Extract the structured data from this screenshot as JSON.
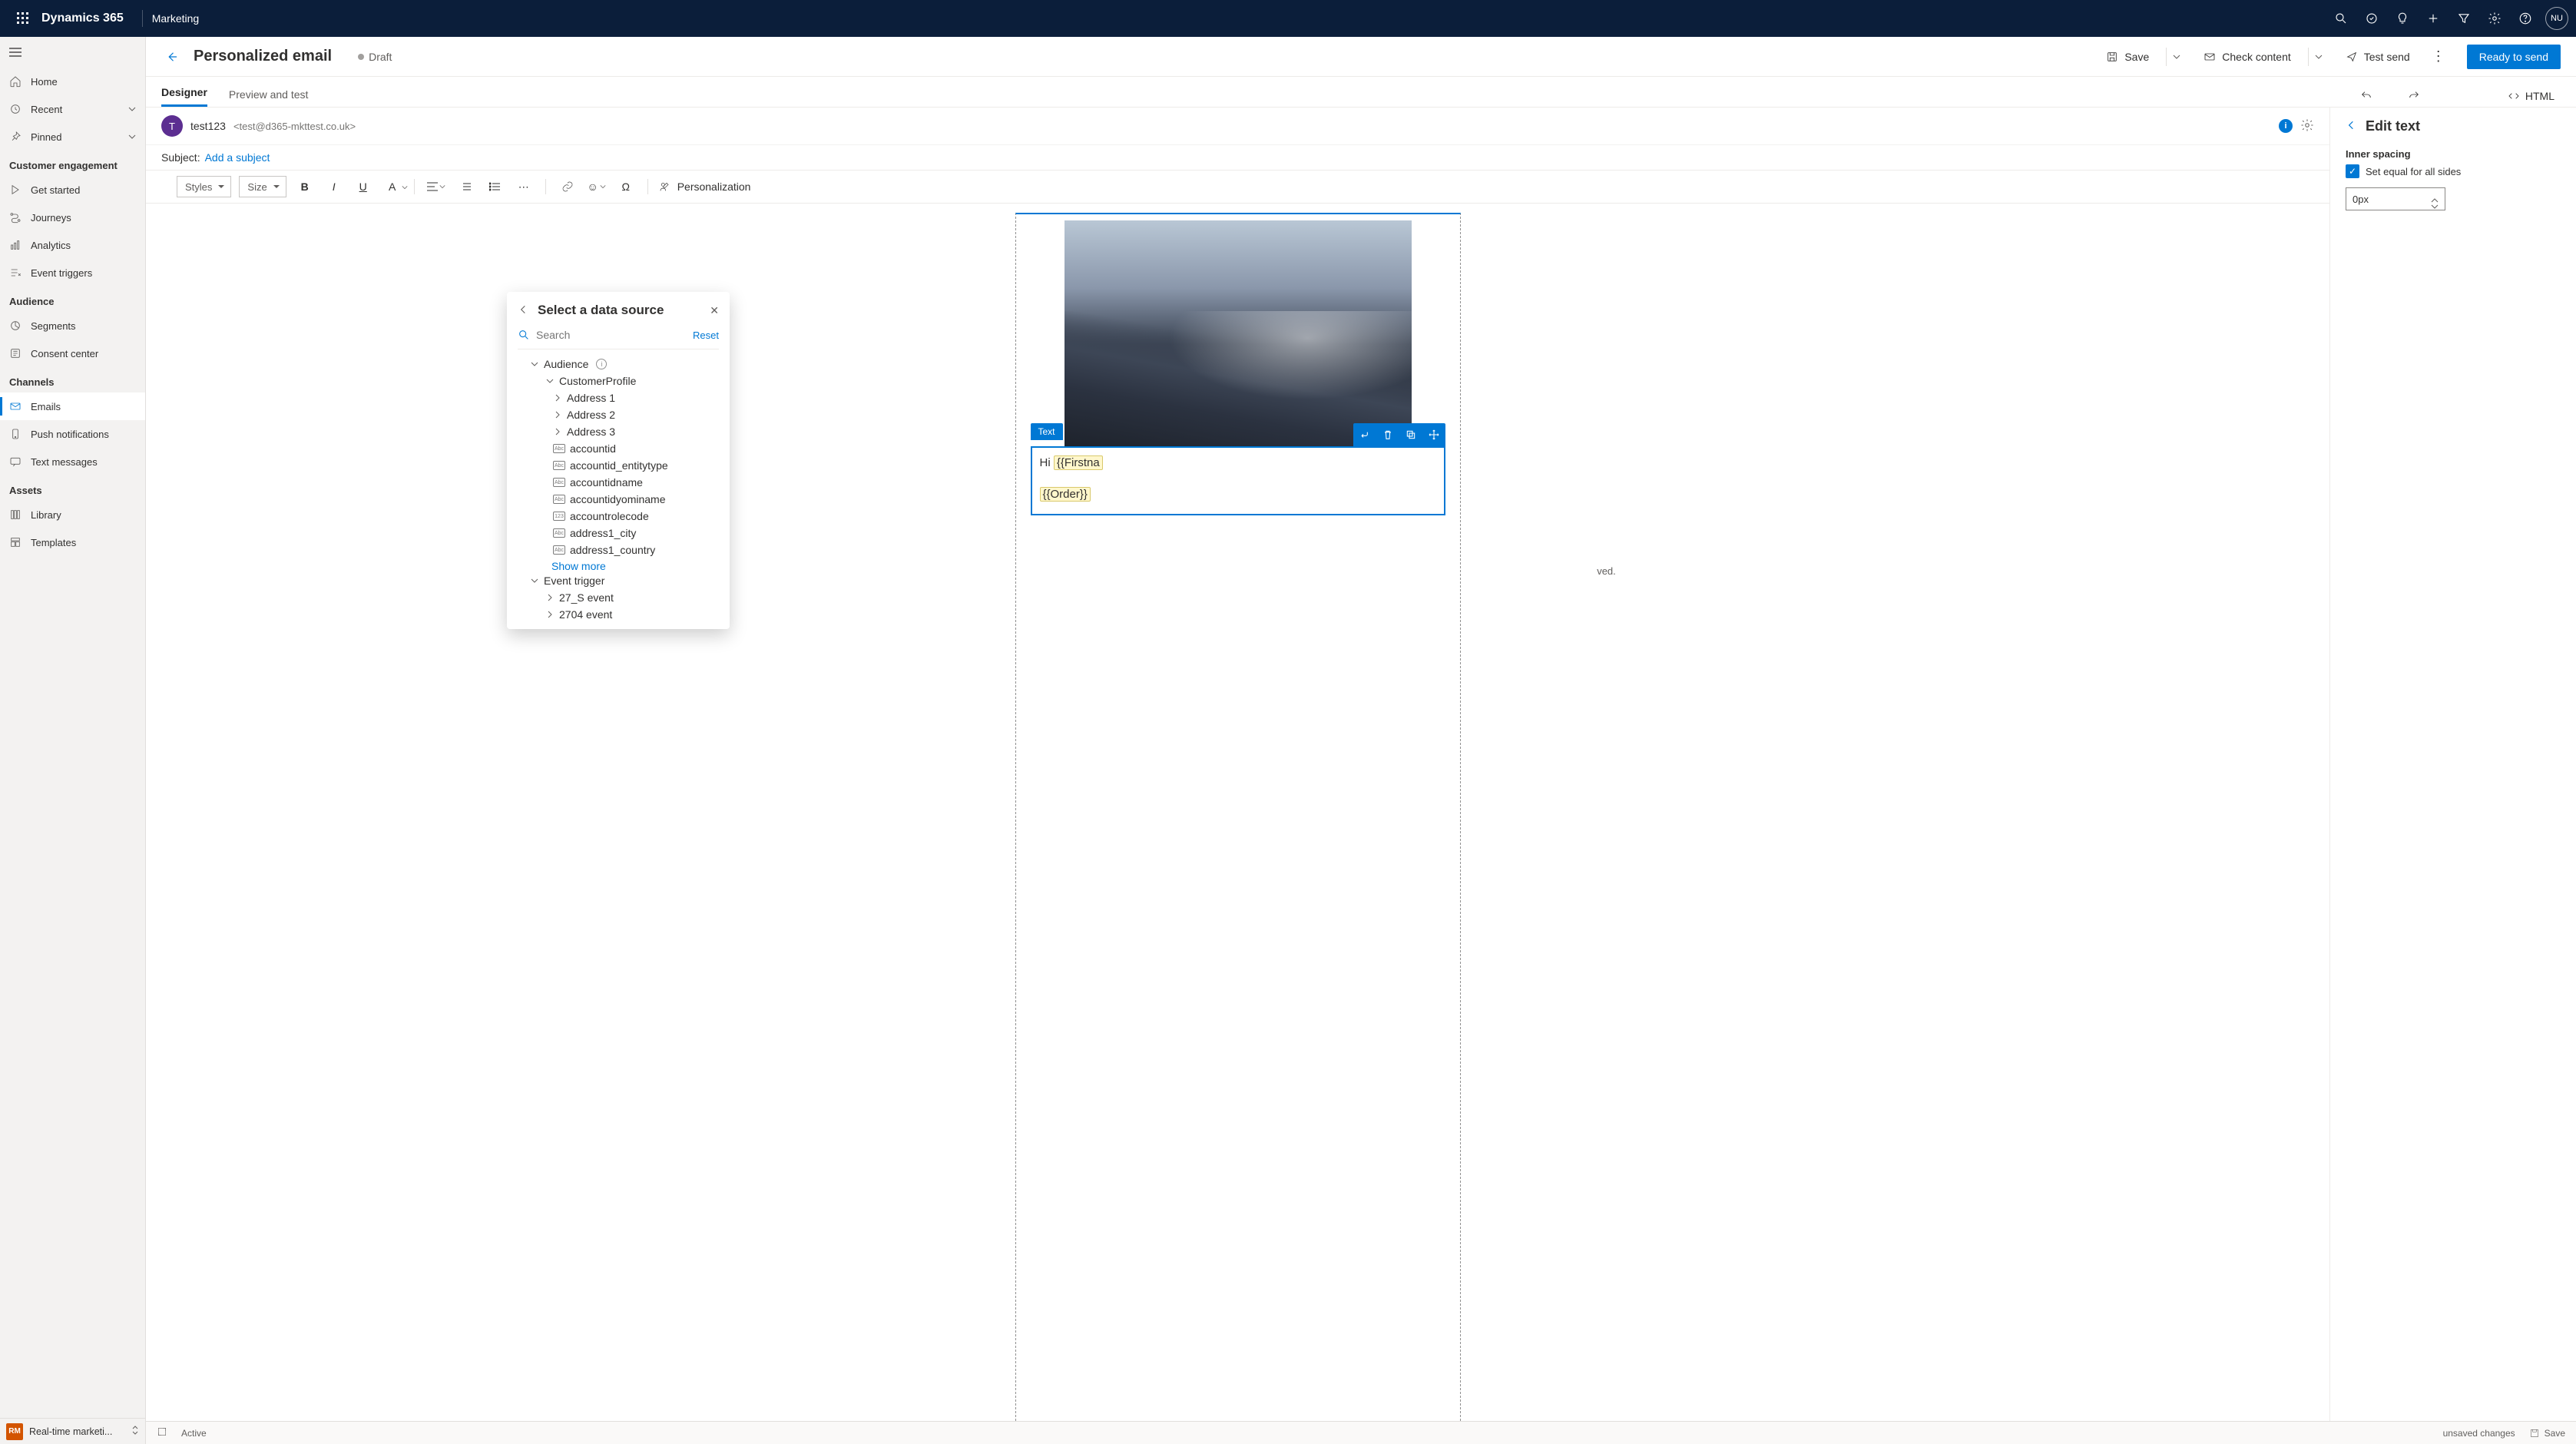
{
  "topbar": {
    "brand": "Dynamics 365",
    "module": "Marketing",
    "avatar": "NU"
  },
  "sidebar": {
    "nav_top": {
      "home": "Home",
      "recent": "Recent",
      "pinned": "Pinned"
    },
    "sections": {
      "engagement": {
        "label": "Customer engagement",
        "items": {
          "get_started": "Get started",
          "journeys": "Journeys",
          "analytics": "Analytics",
          "event_triggers": "Event triggers"
        }
      },
      "audience": {
        "label": "Audience",
        "items": {
          "segments": "Segments",
          "consent": "Consent center"
        }
      },
      "channels": {
        "label": "Channels",
        "items": {
          "emails": "Emails",
          "push": "Push notifications",
          "text": "Text messages"
        }
      },
      "assets": {
        "label": "Assets",
        "items": {
          "library": "Library",
          "templates": "Templates"
        }
      }
    },
    "footer": {
      "badge": "RM",
      "label": "Real-time marketi..."
    }
  },
  "cmdbar": {
    "title": "Personalized email",
    "status": "Draft",
    "save": "Save",
    "check": "Check content",
    "test": "Test send",
    "primary": "Ready to send"
  },
  "tabs": {
    "designer": "Designer",
    "preview": "Preview and test",
    "html": "HTML"
  },
  "from": {
    "avatar": "T",
    "name": "test123",
    "email": "<test@d365-mkttest.co.uk>"
  },
  "subject": {
    "label": "Subject:",
    "link": "Add a subject"
  },
  "editor_toolbar": {
    "styles": "Styles",
    "size": "Size",
    "personalization": "Personalization"
  },
  "canvas": {
    "text_tag": "Text",
    "greeting_prefix": "Hi ",
    "token1": "{{Firstna",
    "token2": "{{Order}}",
    "below_text": "ved."
  },
  "ds_popup": {
    "title": "Select a data source",
    "search_placeholder": "Search",
    "reset": "Reset",
    "audience": "Audience",
    "customer_profile": "CustomerProfile",
    "addr1": "Address 1",
    "addr2": "Address 2",
    "addr3": "Address 3",
    "fields": {
      "accountid": "accountid",
      "accountid_entitytype": "accountid_entitytype",
      "accountidname": "accountidname",
      "accountidyominame": "accountidyominame",
      "accountrolecode": "accountrolecode",
      "address1_city": "address1_city",
      "address1_country": "address1_country"
    },
    "show_more": "Show more",
    "event_trigger": "Event trigger",
    "ev1": "27_S event",
    "ev2": "2704 event"
  },
  "right_panel": {
    "title": "Edit text",
    "inner_spacing": "Inner spacing",
    "equal_sides": "Set equal for all sides",
    "value": "0px"
  },
  "statusbar": {
    "active": "Active",
    "unsaved": "unsaved changes",
    "save": "Save"
  }
}
